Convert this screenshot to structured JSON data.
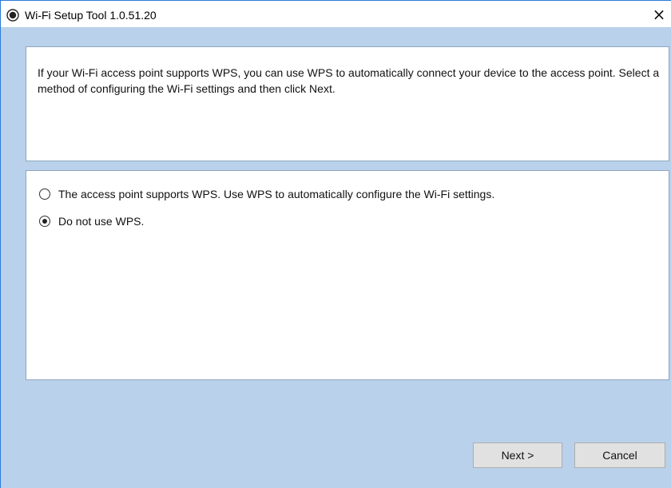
{
  "window": {
    "title": "Wi-Fi Setup Tool 1.0.51.20",
    "close_symbol": "×",
    "icon": "app-icon"
  },
  "info": {
    "text": "If your Wi-Fi access point supports WPS, you can use WPS to automatically connect your device to the access point. Select a method of configuring the Wi-Fi settings and then click Next."
  },
  "options": [
    {
      "label": "The access point supports WPS. Use WPS to automatically configure the Wi-Fi settings.",
      "checked": false
    },
    {
      "label": "Do not use WPS.",
      "checked": true
    }
  ],
  "buttons": {
    "next": "Next >",
    "cancel": "Cancel"
  },
  "colors": {
    "background": "#b9d1ea",
    "panel": "#ffffff",
    "border": "#2b79d8"
  }
}
